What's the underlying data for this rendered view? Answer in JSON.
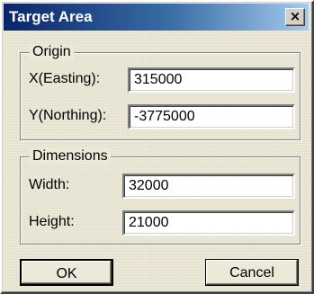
{
  "dialog": {
    "title": "Target Area",
    "close_symbol": "×",
    "close_icon": "close-icon"
  },
  "origin": {
    "legend": "Origin",
    "x_label": "X(Easting):",
    "x_value": "315000",
    "y_label": "Y(Northing):",
    "y_value": "-3775000"
  },
  "dimensions": {
    "legend": "Dimensions",
    "width_label": "Width:",
    "width_value": "32000",
    "height_label": "Height:",
    "height_value": "21000"
  },
  "buttons": {
    "ok": "OK",
    "cancel": "Cancel"
  }
}
